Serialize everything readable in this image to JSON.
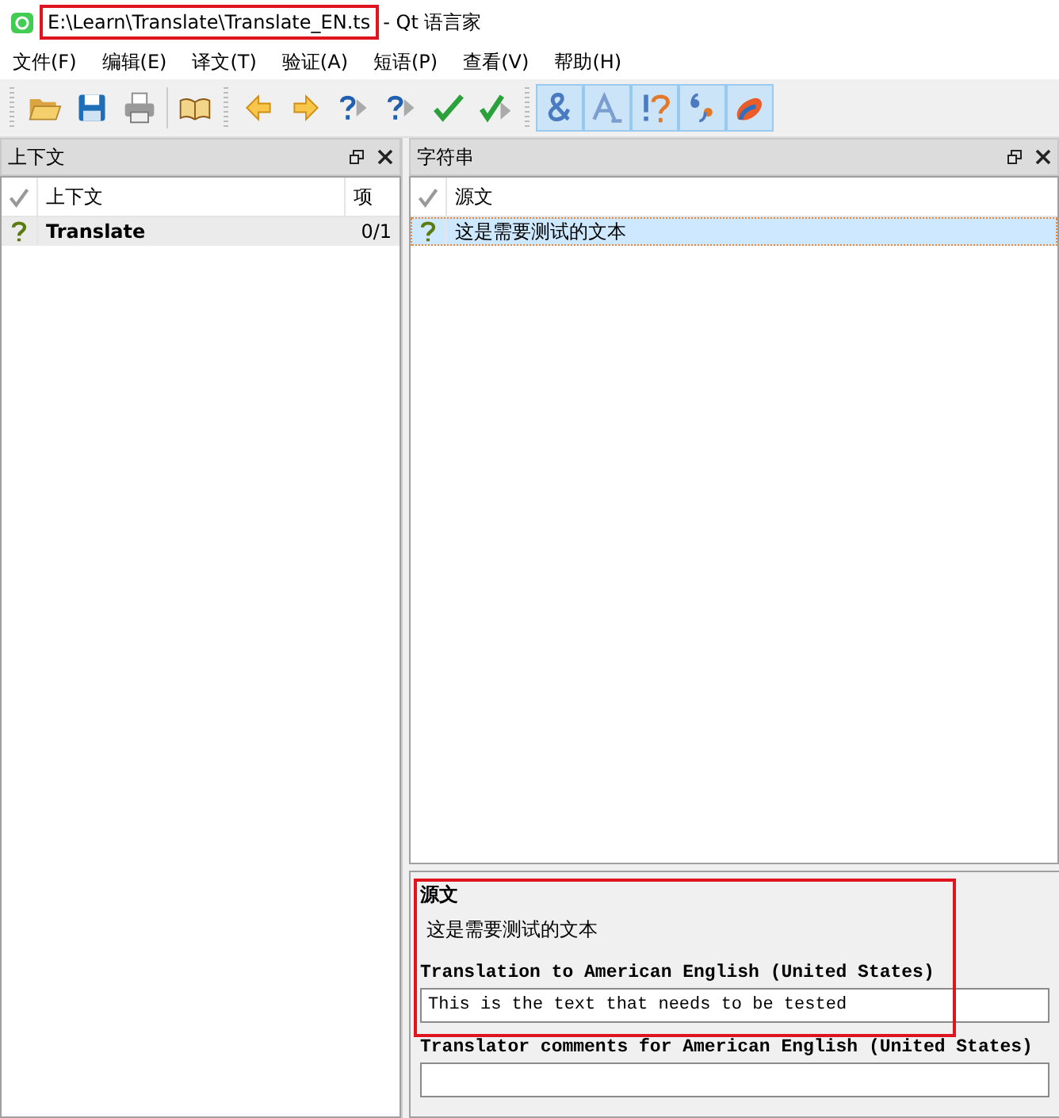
{
  "window": {
    "title": "E:\\Learn\\Translate\\Translate_EN.ts",
    "app_name": "- Qt 语言家"
  },
  "menu": [
    "文件(F)",
    "编辑(E)",
    "译文(T)",
    "验证(A)",
    "短语(P)",
    "查看(V)",
    "帮助(H)"
  ],
  "toolbar": [
    {
      "kind": "open",
      "on": false
    },
    {
      "kind": "save",
      "on": false
    },
    {
      "kind": "print",
      "on": false
    },
    {
      "kind": "book",
      "on": false
    },
    {
      "kind": "prev",
      "on": false
    },
    {
      "kind": "next",
      "on": false
    },
    {
      "kind": "prev-unfinished",
      "on": false
    },
    {
      "kind": "next-unfinished",
      "on": false
    },
    {
      "kind": "done",
      "on": false
    },
    {
      "kind": "done-next",
      "on": false
    },
    {
      "kind": "ampersand",
      "on": true
    },
    {
      "kind": "accelerator",
      "on": true
    },
    {
      "kind": "punctuation",
      "on": true
    },
    {
      "kind": "quotes",
      "on": true
    },
    {
      "kind": "phrase",
      "on": true
    }
  ],
  "context_panel": {
    "title": "上下文",
    "columns": [
      "上下文",
      "项"
    ],
    "rows": [
      {
        "name": "Translate",
        "count": "0/1",
        "selected": true
      }
    ]
  },
  "strings_panel": {
    "title": "字符串",
    "columns": [
      "源文"
    ],
    "rows": [
      {
        "source": "这是需要测试的文本",
        "selected": true
      }
    ]
  },
  "editor": {
    "source_label": "源文",
    "source_text": "这是需要测试的文本",
    "translation_label": "Translation to American English (United States)",
    "translation_value": "This is the text that needs to be tested",
    "comments_label": "Translator comments for American English (United States)"
  }
}
